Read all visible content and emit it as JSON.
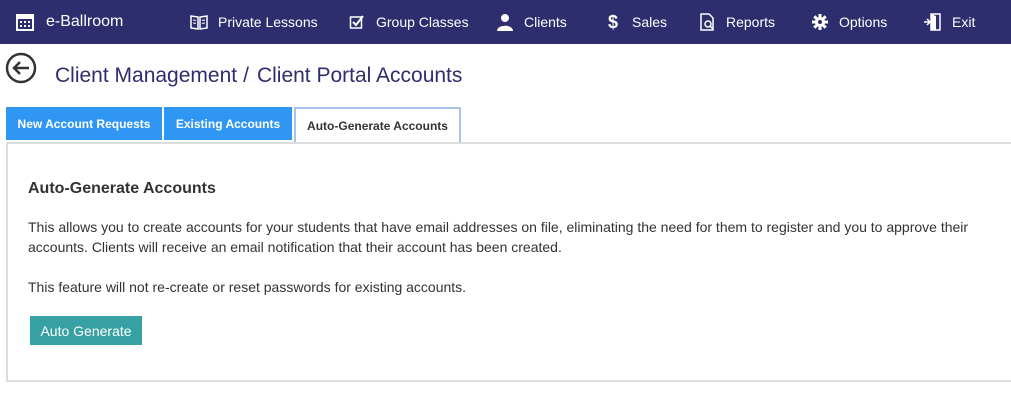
{
  "app": {
    "name": "e-Ballroom",
    "logo_icon": "calendar-icon"
  },
  "nav": {
    "private_lessons": {
      "label": "Private Lessons",
      "icon": "book-icon"
    },
    "group_classes": {
      "label": "Group Classes",
      "icon": "checkbox-icon"
    },
    "clients": {
      "label": "Clients",
      "icon": "person-icon"
    },
    "sales": {
      "label": "Sales",
      "icon": "dollar-icon"
    },
    "reports": {
      "label": "Reports",
      "icon": "report-icon"
    },
    "options": {
      "label": "Options",
      "icon": "gear-icon"
    },
    "exit": {
      "label": "Exit",
      "icon": "exit-door-icon"
    }
  },
  "breadcrumb": {
    "parent": "Client Management",
    "separator": "/",
    "current": "Client Portal Accounts"
  },
  "tabs": [
    {
      "label": "New Account Requests",
      "active": false
    },
    {
      "label": "Existing Accounts",
      "active": false
    },
    {
      "label": "Auto-Generate Accounts",
      "active": true
    }
  ],
  "panel": {
    "title": "Auto-Generate Accounts",
    "description": "This allows you to create accounts for your students that have email addresses on file, eliminating the need for them to register and you to approve their accounts. Clients will receive an email  notification that their account has been created.",
    "note": "This feature will not re-create or reset passwords for existing accounts.",
    "button_label": "Auto Generate"
  },
  "colors": {
    "topbar": "#2e2e6e",
    "tab_blue": "#2f97f3",
    "button_teal": "#36a0a2",
    "heading": "#2e2e6e"
  }
}
